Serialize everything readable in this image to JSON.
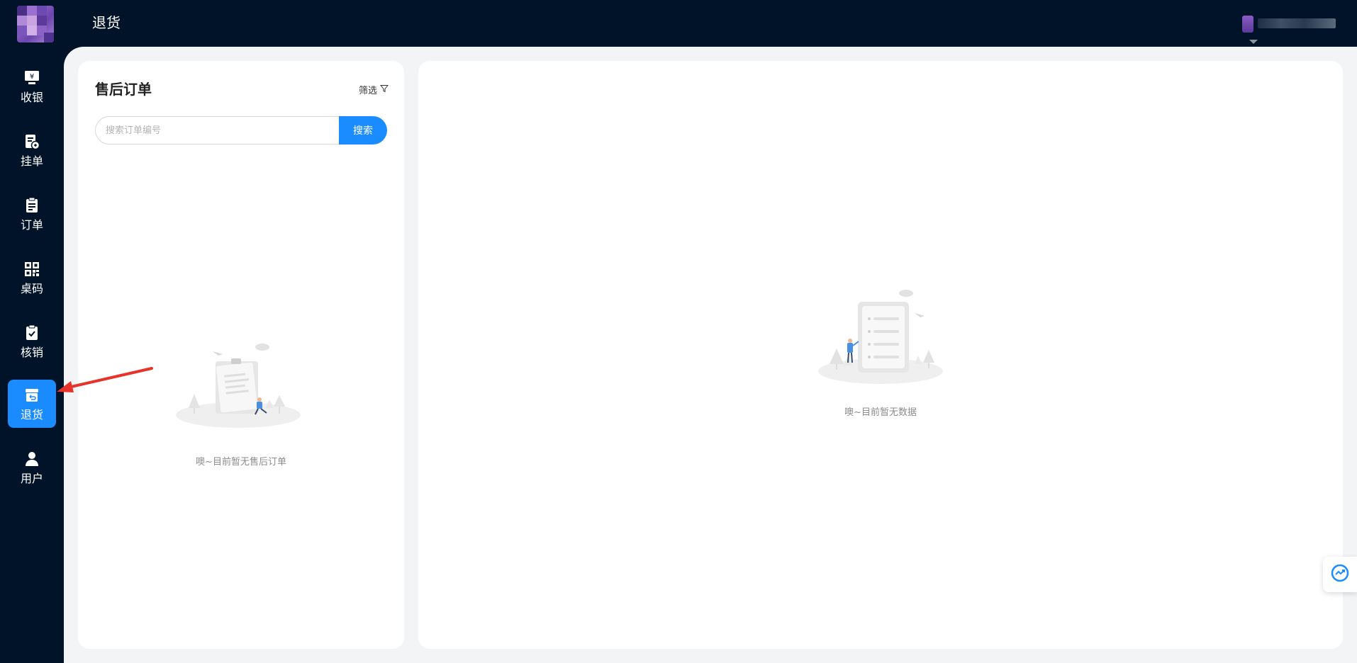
{
  "header": {
    "page_title": "退货"
  },
  "sidebar": {
    "items": [
      {
        "label": "收银",
        "icon": "cashier-icon"
      },
      {
        "label": "挂单",
        "icon": "hold-order-icon"
      },
      {
        "label": "订单",
        "icon": "order-icon"
      },
      {
        "label": "桌码",
        "icon": "qrcode-icon"
      },
      {
        "label": "核销",
        "icon": "verify-icon"
      },
      {
        "label": "退货",
        "icon": "return-icon",
        "active": true
      },
      {
        "label": "用户",
        "icon": "user-icon"
      }
    ]
  },
  "left_panel": {
    "title": "售后订单",
    "filter_label": "筛选",
    "search_placeholder": "搜索订单编号",
    "search_button": "搜索",
    "empty_text": "噢~目前暂无售后订单"
  },
  "right_panel": {
    "empty_text": "噢~目前暂无数据"
  },
  "colors": {
    "sidebar_bg": "#001328",
    "accent": "#1a8cff",
    "content_bg": "#f3f4f6",
    "annotation": "#e8332a"
  }
}
